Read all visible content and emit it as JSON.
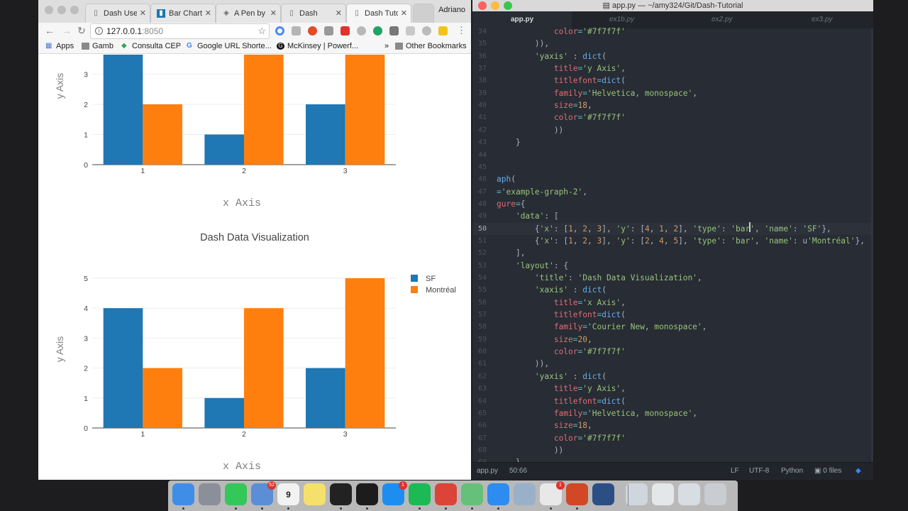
{
  "browser": {
    "profile": "Adriano",
    "tabs": [
      {
        "label": "Dash User",
        "icon": "doc-icon"
      },
      {
        "label": "Bar Charts",
        "icon": "bar-chart-icon"
      },
      {
        "label": "A Pen by",
        "icon": "codepen-icon"
      },
      {
        "label": "Dash",
        "icon": "doc-icon"
      },
      {
        "label": "Dash Tuto",
        "icon": "doc-icon"
      }
    ],
    "url_host": "127.0.0.1",
    "url_port": ":8050",
    "bookmarks": [
      {
        "label": "Apps",
        "icon": "apps-grid-icon"
      },
      {
        "label": "Gamb",
        "icon": "folder-icon"
      },
      {
        "label": "Consulta CEP",
        "icon": "consulta-icon"
      },
      {
        "label": "Google URL Shorte...",
        "icon": "google-icon"
      },
      {
        "label": "McKinsey | Powerf...",
        "icon": "mckinsey-icon"
      }
    ],
    "overflow_label": "»",
    "other_bookmarks": "Other Bookmarks"
  },
  "page": {
    "top_chart": {
      "ylabel": "y Axis",
      "xlabel": "x Axis",
      "y_ticks": [
        "0",
        "1",
        "2",
        "3"
      ],
      "x_ticks": [
        "1",
        "2",
        "3"
      ]
    },
    "bottom_chart": {
      "title": "Dash Data Visualization",
      "ylabel": "y Axis",
      "xlabel": "x Axis",
      "y_ticks": [
        "0",
        "1",
        "2",
        "3",
        "4",
        "5"
      ],
      "x_ticks": [
        "1",
        "2",
        "3"
      ]
    }
  },
  "chart_data": [
    {
      "type": "bar",
      "categories": [
        "1",
        "2",
        "3"
      ],
      "series": [
        {
          "name": "SF",
          "values": [
            4,
            1,
            2
          ],
          "color": "#1f77b4"
        },
        {
          "name": "Montréal",
          "values": [
            2,
            4,
            5
          ],
          "color": "#ff7f0e"
        }
      ],
      "xlabel": "x Axis",
      "ylabel": "y Axis",
      "ylim": [
        0,
        3.6
      ],
      "grid": true,
      "legend": "none"
    },
    {
      "type": "bar",
      "title": "Dash Data Visualization",
      "categories": [
        "1",
        "2",
        "3"
      ],
      "series": [
        {
          "name": "SF",
          "values": [
            4,
            1,
            2
          ],
          "color": "#1f77b4"
        },
        {
          "name": "Montréal",
          "values": [
            2,
            4,
            5
          ],
          "color": "#ff7f0e"
        }
      ],
      "xlabel": "x Axis",
      "ylabel": "y Axis",
      "ylim": [
        0,
        5
      ],
      "grid": true,
      "legend": "top-right"
    }
  ],
  "editor": {
    "window_title": "app.py — ~/amy324/Git/Dash-Tutorial",
    "tabs": [
      "app.py",
      "ex1b.py",
      "ex2.py",
      "ex3.py"
    ],
    "status": {
      "file": "app.py",
      "position": "50:66",
      "line_ending": "LF",
      "encoding": "UTF-8",
      "grammar": "Python",
      "files": "0 files"
    },
    "lines": [
      {
        "n": "34",
        "tokens": [
          [
            "pl",
            "            "
          ],
          [
            "kw",
            "color"
          ],
          [
            "op",
            "="
          ],
          [
            "str",
            "'#7f7f7f'"
          ]
        ]
      },
      {
        "n": "35",
        "tokens": [
          [
            "pl",
            "        )),"
          ]
        ]
      },
      {
        "n": "36",
        "tokens": [
          [
            "pl",
            "        "
          ],
          [
            "str",
            "'yaxis'"
          ],
          [
            "pl",
            " : "
          ],
          [
            "fn",
            "dict"
          ],
          [
            "pl",
            "("
          ]
        ]
      },
      {
        "n": "37",
        "tokens": [
          [
            "pl",
            "            "
          ],
          [
            "kw",
            "title"
          ],
          [
            "op",
            "="
          ],
          [
            "str",
            "'y Axis'"
          ],
          [
            "pl",
            ","
          ]
        ]
      },
      {
        "n": "38",
        "tokens": [
          [
            "pl",
            "            "
          ],
          [
            "kw",
            "titlefont"
          ],
          [
            "op",
            "="
          ],
          [
            "fn",
            "dict"
          ],
          [
            "pl",
            "("
          ]
        ]
      },
      {
        "n": "39",
        "tokens": [
          [
            "pl",
            "            "
          ],
          [
            "kw",
            "family"
          ],
          [
            "op",
            "="
          ],
          [
            "str",
            "'Helvetica, monospace'"
          ],
          [
            "pl",
            ","
          ]
        ]
      },
      {
        "n": "40",
        "tokens": [
          [
            "pl",
            "            "
          ],
          [
            "kw",
            "size"
          ],
          [
            "op",
            "="
          ],
          [
            "num",
            "18"
          ],
          [
            "pl",
            ","
          ]
        ]
      },
      {
        "n": "41",
        "tokens": [
          [
            "pl",
            "            "
          ],
          [
            "kw",
            "color"
          ],
          [
            "op",
            "="
          ],
          [
            "str",
            "'#7f7f7f'"
          ]
        ]
      },
      {
        "n": "42",
        "tokens": [
          [
            "pl",
            "            ))"
          ]
        ]
      },
      {
        "n": "43",
        "tokens": [
          [
            "pl",
            "    }"
          ]
        ]
      },
      {
        "n": "44",
        "tokens": []
      },
      {
        "n": "45",
        "tokens": []
      },
      {
        "n": "46",
        "tokens": [
          [
            "fn",
            "aph"
          ],
          [
            "pl",
            "("
          ]
        ]
      },
      {
        "n": "47",
        "tokens": [
          [
            "op",
            "="
          ],
          [
            "str",
            "'example-graph-2'"
          ],
          [
            "pl",
            ","
          ]
        ]
      },
      {
        "n": "48",
        "tokens": [
          [
            "kw",
            "gure"
          ],
          [
            "op",
            "="
          ],
          [
            "pl",
            "{"
          ]
        ]
      },
      {
        "n": "49",
        "tokens": [
          [
            "pl",
            "    "
          ],
          [
            "str",
            "'data'"
          ],
          [
            "pl",
            ": ["
          ]
        ]
      },
      {
        "n": "50",
        "tokens": [
          [
            "pl",
            "        {"
          ],
          [
            "str",
            "'x'"
          ],
          [
            "pl",
            ": ["
          ],
          [
            "num",
            "1"
          ],
          [
            "pl",
            ", "
          ],
          [
            "num",
            "2"
          ],
          [
            "pl",
            ", "
          ],
          [
            "num",
            "3"
          ],
          [
            "pl",
            "], "
          ],
          [
            "str",
            "'y'"
          ],
          [
            "pl",
            ": ["
          ],
          [
            "num",
            "4"
          ],
          [
            "pl",
            ", "
          ],
          [
            "num",
            "1"
          ],
          [
            "pl",
            ", "
          ],
          [
            "num",
            "2"
          ],
          [
            "pl",
            "], "
          ],
          [
            "str",
            "'type'"
          ],
          [
            "pl",
            ": "
          ],
          [
            "str",
            "'bar'"
          ],
          [
            "pl",
            ", "
          ],
          [
            "str",
            "'name'"
          ],
          [
            "pl",
            ": "
          ],
          [
            "str",
            "'SF'"
          ],
          [
            "pl",
            "},"
          ]
        ]
      },
      {
        "n": "51",
        "tokens": [
          [
            "pl",
            "        {"
          ],
          [
            "str",
            "'x'"
          ],
          [
            "pl",
            ": ["
          ],
          [
            "num",
            "1"
          ],
          [
            "pl",
            ", "
          ],
          [
            "num",
            "2"
          ],
          [
            "pl",
            ", "
          ],
          [
            "num",
            "3"
          ],
          [
            "pl",
            "], "
          ],
          [
            "str",
            "'y'"
          ],
          [
            "pl",
            ": ["
          ],
          [
            "num",
            "2"
          ],
          [
            "pl",
            ", "
          ],
          [
            "num",
            "4"
          ],
          [
            "pl",
            ", "
          ],
          [
            "num",
            "5"
          ],
          [
            "pl",
            "], "
          ],
          [
            "str",
            "'type'"
          ],
          [
            "pl",
            ": "
          ],
          [
            "str",
            "'bar'"
          ],
          [
            "pl",
            ", "
          ],
          [
            "str",
            "'name'"
          ],
          [
            "pl",
            ": u"
          ],
          [
            "str",
            "'Montréal'"
          ],
          [
            "pl",
            "},"
          ]
        ]
      },
      {
        "n": "52",
        "tokens": [
          [
            "pl",
            "    ],"
          ]
        ]
      },
      {
        "n": "53",
        "tokens": [
          [
            "pl",
            "    "
          ],
          [
            "str",
            "'layout'"
          ],
          [
            "pl",
            ": {"
          ]
        ]
      },
      {
        "n": "54",
        "tokens": [
          [
            "pl",
            "        "
          ],
          [
            "str",
            "'title'"
          ],
          [
            "pl",
            ": "
          ],
          [
            "str",
            "'Dash Data Visualization'"
          ],
          [
            "pl",
            ","
          ]
        ]
      },
      {
        "n": "55",
        "tokens": [
          [
            "pl",
            "        "
          ],
          [
            "str",
            "'xaxis'"
          ],
          [
            "pl",
            " : "
          ],
          [
            "fn",
            "dict"
          ],
          [
            "pl",
            "("
          ]
        ]
      },
      {
        "n": "56",
        "tokens": [
          [
            "pl",
            "            "
          ],
          [
            "kw",
            "title"
          ],
          [
            "op",
            "="
          ],
          [
            "str",
            "'x Axis'"
          ],
          [
            "pl",
            ","
          ]
        ]
      },
      {
        "n": "57",
        "tokens": [
          [
            "pl",
            "            "
          ],
          [
            "kw",
            "titlefont"
          ],
          [
            "op",
            "="
          ],
          [
            "fn",
            "dict"
          ],
          [
            "pl",
            "("
          ]
        ]
      },
      {
        "n": "58",
        "tokens": [
          [
            "pl",
            "            "
          ],
          [
            "kw",
            "family"
          ],
          [
            "op",
            "="
          ],
          [
            "str",
            "'Courier New, monospace'"
          ],
          [
            "pl",
            ","
          ]
        ]
      },
      {
        "n": "59",
        "tokens": [
          [
            "pl",
            "            "
          ],
          [
            "kw",
            "size"
          ],
          [
            "op",
            "="
          ],
          [
            "num",
            "20"
          ],
          [
            "pl",
            ","
          ]
        ]
      },
      {
        "n": "60",
        "tokens": [
          [
            "pl",
            "            "
          ],
          [
            "kw",
            "color"
          ],
          [
            "op",
            "="
          ],
          [
            "str",
            "'#7f7f7f'"
          ]
        ]
      },
      {
        "n": "61",
        "tokens": [
          [
            "pl",
            "        )),"
          ]
        ]
      },
      {
        "n": "62",
        "tokens": [
          [
            "pl",
            "        "
          ],
          [
            "str",
            "'yaxis'"
          ],
          [
            "pl",
            " : "
          ],
          [
            "fn",
            "dict"
          ],
          [
            "pl",
            "("
          ]
        ]
      },
      {
        "n": "63",
        "tokens": [
          [
            "pl",
            "            "
          ],
          [
            "kw",
            "title"
          ],
          [
            "op",
            "="
          ],
          [
            "str",
            "'y Axis'"
          ],
          [
            "pl",
            ","
          ]
        ]
      },
      {
        "n": "64",
        "tokens": [
          [
            "pl",
            "            "
          ],
          [
            "kw",
            "titlefont"
          ],
          [
            "op",
            "="
          ],
          [
            "fn",
            "dict"
          ],
          [
            "pl",
            "("
          ]
        ]
      },
      {
        "n": "65",
        "tokens": [
          [
            "pl",
            "            "
          ],
          [
            "kw",
            "family"
          ],
          [
            "op",
            "="
          ],
          [
            "str",
            "'Helvetica, monospace'"
          ],
          [
            "pl",
            ","
          ]
        ]
      },
      {
        "n": "66",
        "tokens": [
          [
            "pl",
            "            "
          ],
          [
            "kw",
            "size"
          ],
          [
            "op",
            "="
          ],
          [
            "num",
            "18"
          ],
          [
            "pl",
            ","
          ]
        ]
      },
      {
        "n": "67",
        "tokens": [
          [
            "pl",
            "            "
          ],
          [
            "kw",
            "color"
          ],
          [
            "op",
            "="
          ],
          [
            "str",
            "'#7f7f7f'"
          ]
        ]
      },
      {
        "n": "68",
        "tokens": [
          [
            "pl",
            "            ))"
          ]
        ]
      },
      {
        "n": "69",
        "tokens": [
          [
            "pl",
            "    },"
          ]
        ]
      }
    ],
    "current_line": "50"
  },
  "dock": {
    "apps": [
      {
        "name": "finder-icon",
        "color": "#3e8ee8"
      },
      {
        "name": "launchpad-icon",
        "color": "#8a8f99"
      },
      {
        "name": "facetime-icon",
        "color": "#34c759"
      },
      {
        "name": "mail-stamp-icon",
        "color": "#5b8ed6",
        "badge": "52"
      },
      {
        "name": "calendar-icon",
        "color": "#f2f2f2",
        "label": "9"
      },
      {
        "name": "notes-icon",
        "color": "#f5e06b"
      },
      {
        "name": "terminal-icon",
        "color": "#222222"
      },
      {
        "name": "activity-monitor-icon",
        "color": "#1c1c1c"
      },
      {
        "name": "app-store-icon",
        "color": "#1d8ef0",
        "badge": "1"
      },
      {
        "name": "spotify-icon",
        "color": "#1db954"
      },
      {
        "name": "chrome-icon",
        "color": "#db4437"
      },
      {
        "name": "atom-icon",
        "color": "#66c07a"
      },
      {
        "name": "messenger-icon",
        "color": "#2d8cf0"
      },
      {
        "name": "preview-icon",
        "color": "#9ab0c8"
      },
      {
        "name": "skype-icon",
        "color": "#e8e8e8",
        "badge": "1"
      },
      {
        "name": "powerpoint-icon",
        "color": "#d24726"
      },
      {
        "name": "quicktime-icon",
        "color": "#2b4f85"
      },
      {
        "name": "docs-stack-icon",
        "color": "#cfd6de"
      },
      {
        "name": "docs-stack-2-icon",
        "color": "#e4e7ea"
      },
      {
        "name": "downloads-stack-icon",
        "color": "#d8dde3"
      },
      {
        "name": "trash-icon",
        "color": "#c9ccd0"
      }
    ]
  }
}
